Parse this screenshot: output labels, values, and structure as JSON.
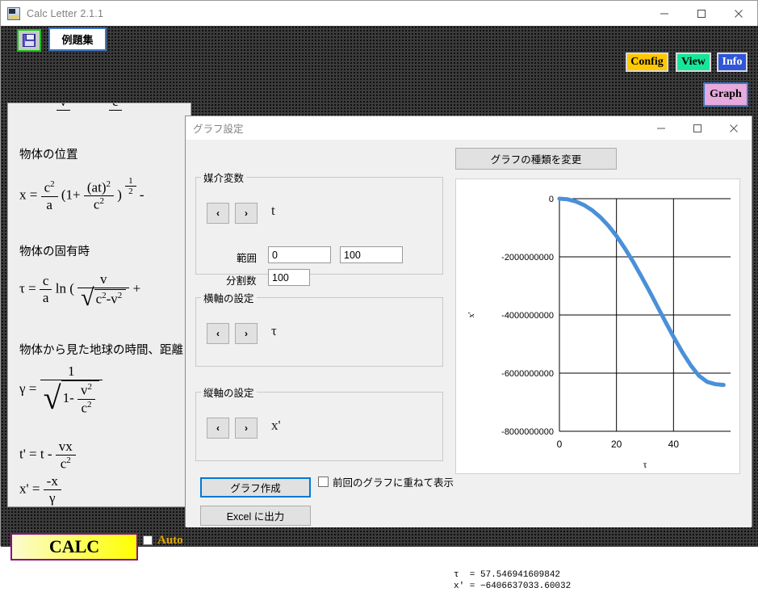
{
  "app": {
    "title": "Calc Letter 2.1.1",
    "icon": "app-icon",
    "window_controls": {
      "minimize": "–",
      "maximize": "☐",
      "close": "✕"
    }
  },
  "toolbar": {
    "save_icon": "floppy-disk-icon",
    "example_label": "例題集",
    "config_label": "Config",
    "view_label": "View",
    "info_label": "Info",
    "graph_label": "Graph",
    "colors": {
      "config": "#ffc800",
      "view": "#16e69a",
      "info": "#2f56d8",
      "graph": "#e6aadc",
      "save_border": "#19c219",
      "example_border": "#3e78c8"
    }
  },
  "formulas": {
    "heading_position": "物体の位置",
    "heading_propertime": "物体の固有時",
    "heading_earthview": "物体から見た地球の時間、距離",
    "x_eq": "x  =",
    "x_c": "c",
    "x_c_sup": "2",
    "x_a": "a",
    "x_open": "(1+",
    "x_at": "(at)",
    "x_at_sup": "2",
    "x_c2": "c",
    "x_c2_sup": "2",
    "x_close": ")",
    "x_exp_num": "1",
    "x_exp_den": "2",
    "x_minus": "-",
    "tau_eq": "τ  =",
    "tau_c": "c",
    "tau_a": "a",
    "tau_ln": "ln  (",
    "tau_v": "v",
    "tau_rc": "c",
    "tau_rc_sup": "2",
    "tau_rv": "-v",
    "tau_rv_sup": "2",
    "tau_plus": "+",
    "g_eq": "γ  =",
    "g_one": "1",
    "g_1minus": "1-",
    "g_v": "v",
    "g_v_sup": "2",
    "g_c": "c",
    "g_c_sup": "2",
    "tp_eq": "t'  =  t  -",
    "tp_vx": "vx",
    "tp_c": "c",
    "tp_c_sup": "2",
    "xp_eq": "x'  =",
    "xp_num": "-x",
    "xp_den": "γ",
    "top_partial_v": "v",
    "top_partial_c": "c"
  },
  "calc": {
    "label": "CALC",
    "auto_label": "Auto",
    "auto_checked": false
  },
  "dialog": {
    "title": "グラフ設定",
    "window_controls": {
      "minimize": "–",
      "maximize": "☐",
      "close": "✕"
    },
    "param_group": {
      "legend": "媒介変数",
      "prev_icon": "‹",
      "next_icon": "›",
      "variable": "t",
      "range_label": "範囲",
      "range_min": "0",
      "range_max": "100",
      "divisions_label": "分割数",
      "divisions": "100"
    },
    "xaxis_group": {
      "legend": "横軸の設定",
      "prev_icon": "‹",
      "next_icon": "›",
      "variable": "τ"
    },
    "yaxis_group": {
      "legend": "縦軸の設定",
      "prev_icon": "‹",
      "next_icon": "›",
      "variable": "x'"
    },
    "make_graph_label": "グラフ作成",
    "excel_label": "Excel に出力",
    "overlay_label": "前回のグラフに重ねて表示",
    "overlay_checked": false,
    "change_type_label": "グラフの種類を変更",
    "result_line1": "τ  = 57.546941609842",
    "result_line2": "x' = −6406637033.60032"
  },
  "chart_data": {
    "type": "line",
    "title": "",
    "xlabel": "τ",
    "ylabel": "x'",
    "xlim": [
      0,
      57.546941609842
    ],
    "ylim": [
      -8000000000,
      0
    ],
    "xticks": [
      0,
      20,
      40
    ],
    "xticklabels": [
      "0",
      "20",
      "40"
    ],
    "yticks": [
      0,
      -2000000000,
      -4000000000,
      -6000000000,
      -8000000000
    ],
    "yticklabels": [
      "0",
      "-2000000000",
      "-4000000000",
      "-6000000000",
      "-8000000000"
    ],
    "grid": true,
    "legend": "none",
    "line_color": "#4a90d9",
    "line_width": 5,
    "series": [
      {
        "name": "x'",
        "x": [
          0,
          2.88,
          5.75,
          8.63,
          11.51,
          14.39,
          17.26,
          20.14,
          23.02,
          25.9,
          28.77,
          31.65,
          34.53,
          37.41,
          40.28,
          43.16,
          46.04,
          48.92,
          51.79,
          54.67,
          57.55
        ],
        "y": [
          0,
          -22000000,
          -95000000,
          -220000000,
          -400000000,
          -640000000,
          -940000000,
          -1300000000,
          -1720000000,
          -2180000000,
          -2680000000,
          -3200000000,
          -3740000000,
          -4280000000,
          -4800000000,
          -5290000000,
          -5730000000,
          -6090000000,
          -6300000000,
          -6380000000,
          -6406637034
        ]
      }
    ]
  }
}
